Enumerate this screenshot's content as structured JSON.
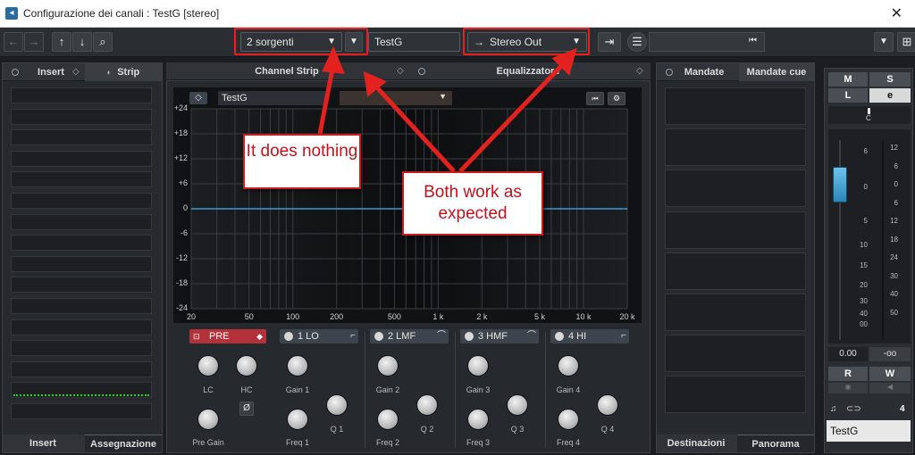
{
  "window": {
    "title": "Configurazione dei canali : TestG [stereo]",
    "close": "✕"
  },
  "toolbar": {
    "back": "←",
    "forward": "→",
    "up": "↑",
    "down": "↓",
    "search": "⌕",
    "input_routing": "2 sorgenti",
    "channel_name": "TestG",
    "output_routing": "Stereo Out",
    "expand": "▾"
  },
  "left_panel": {
    "tab_insert": "Insert",
    "tab_strip": "Strip",
    "bottom_insert": "Insert",
    "bottom_assign": "Assegnazione"
  },
  "center_panel": {
    "tab_channel_strip": "Channel Strip",
    "tab_eq": "Equalizzatore",
    "eq_channel": "TestG",
    "preset": "",
    "y_ticks": [
      "+24",
      "+18",
      "+12",
      "+6",
      "0",
      "-6",
      "-12",
      "-18",
      "-24"
    ],
    "x_ticks": [
      "20",
      "50",
      "100",
      "200",
      "500",
      "1 k",
      "2 k",
      "5 k",
      "10 k",
      "20 k"
    ],
    "pre_label": "PRE",
    "lc_label": "LC",
    "hc_label": "HC",
    "pregain_label": "Pre Gain",
    "phase": "Ø",
    "bands": [
      {
        "name": "1 LO",
        "gain": "Gain 1",
        "freq": "Freq 1",
        "q": "Q 1"
      },
      {
        "name": "2 LMF",
        "gain": "Gain 2",
        "freq": "Freq 2",
        "q": "Q 2"
      },
      {
        "name": "3 HMF",
        "gain": "Gain 3",
        "freq": "Freq 3",
        "q": "Q 3"
      },
      {
        "name": "4 HI",
        "gain": "Gain 4",
        "freq": "Freq 4",
        "q": "Q 4"
      }
    ]
  },
  "right_panel": {
    "tab_sends": "Mandate",
    "tab_cue": "Mandate cue",
    "bottom_dest": "Destinazioni",
    "bottom_pan": "Panorama"
  },
  "fader": {
    "m": "M",
    "s": "S",
    "l": "L",
    "e": "e",
    "pan_c": "C",
    "scale_left": [
      "6",
      "0",
      "5",
      "10",
      "15",
      "20",
      "30",
      "40",
      "00"
    ],
    "scale_right": [
      "12",
      "6",
      "0",
      "6",
      "12",
      "18",
      "24",
      "30",
      "40",
      "50"
    ],
    "volume": "0.00",
    "peak": "-oo",
    "r": "R",
    "w": "W",
    "number": "4",
    "name": "TestG"
  },
  "annotations": {
    "does_nothing": "It does nothing",
    "both_work": "Both work as expected"
  },
  "colors": {
    "accent_red": "#e3221f",
    "eq_line": "#3a9bd9",
    "meter_green": "#2fd12f",
    "fader_blue": "#3aa0d8"
  }
}
